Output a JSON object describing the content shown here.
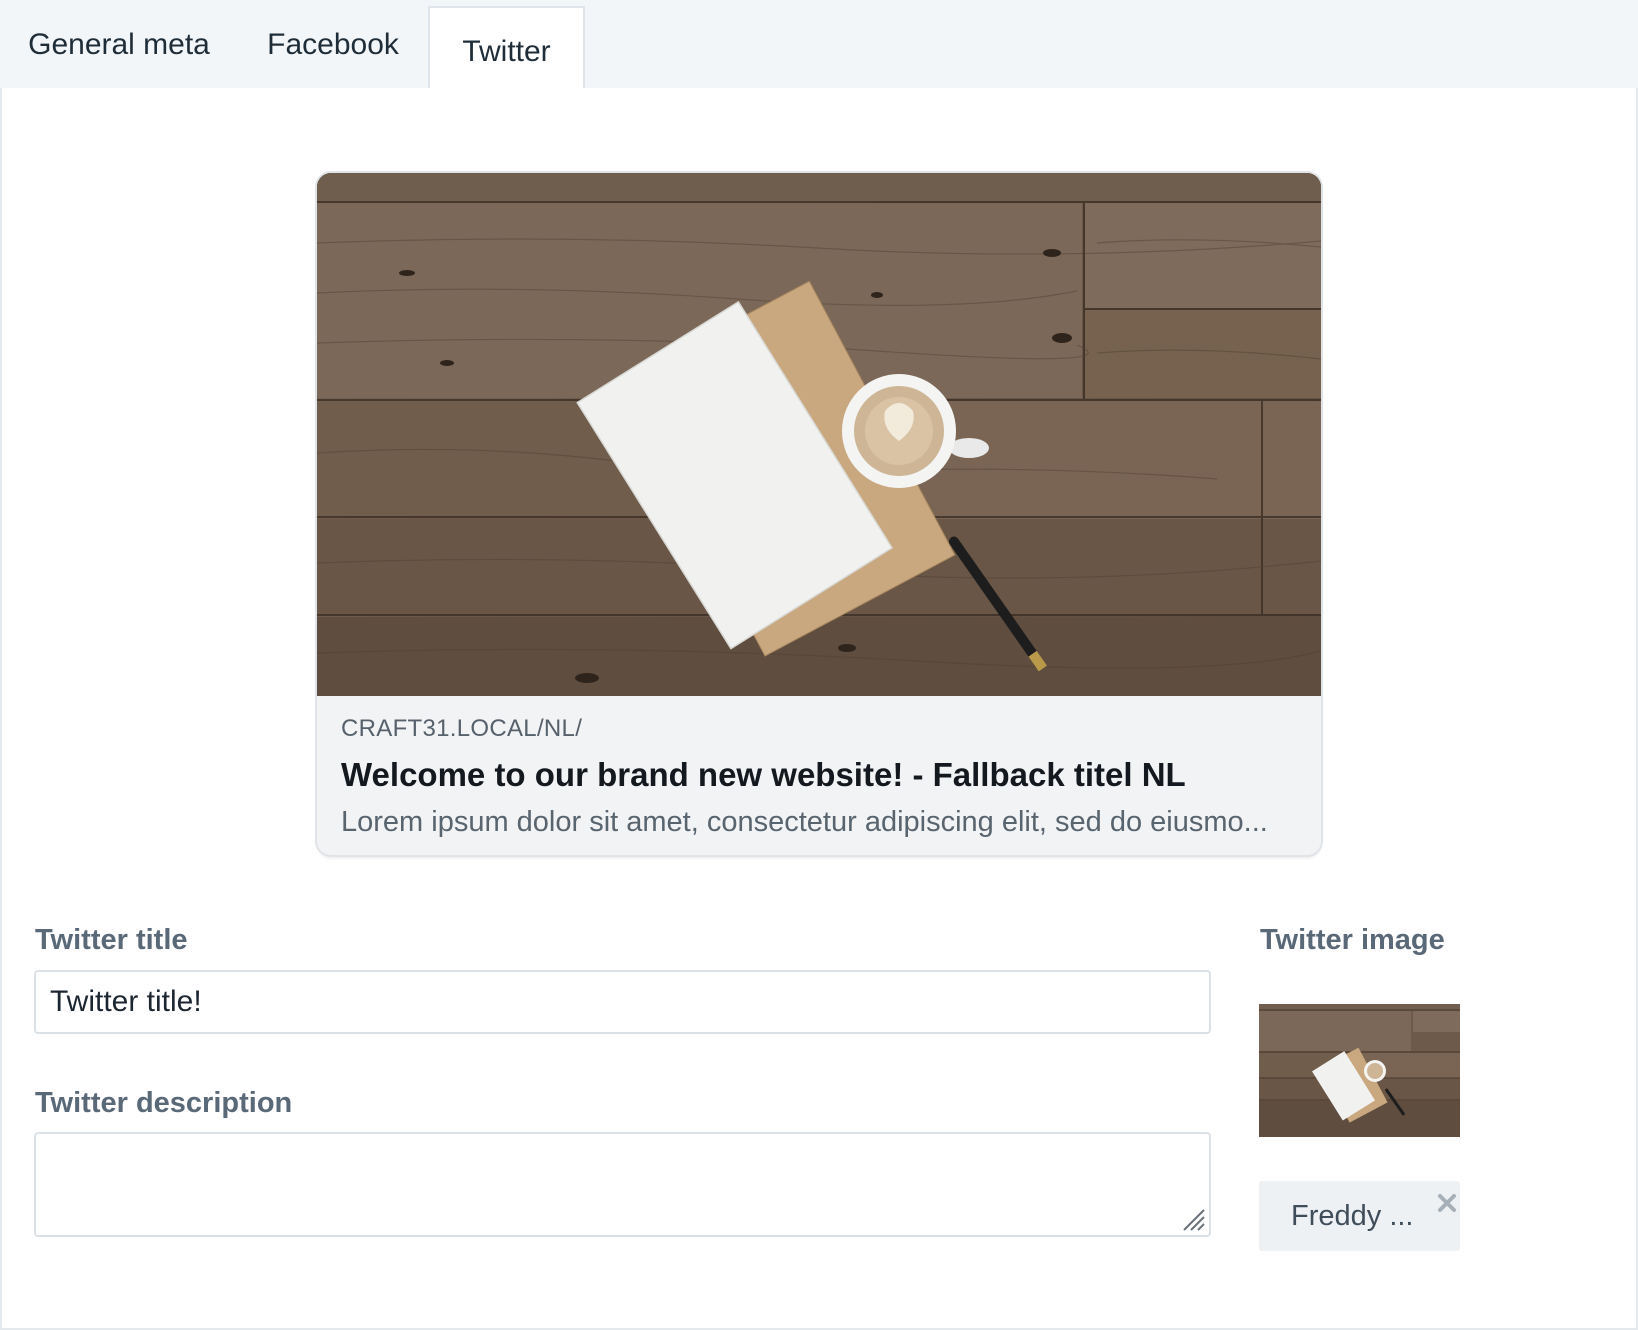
{
  "tabs": [
    {
      "label": "General meta",
      "active": false
    },
    {
      "label": "Facebook",
      "active": false
    },
    {
      "label": "Twitter",
      "active": true
    }
  ],
  "preview": {
    "image": "wooden-desk-with-notebooks-coffee-and-pen",
    "domain": "CRAFT31.LOCAL/NL/",
    "title": "Welcome to our brand new website! - Fallback titel NL",
    "description": "Lorem ipsum dolor sit amet, consectetur adipiscing elit, sed do eiusmo..."
  },
  "fields": {
    "title": {
      "label": "Twitter title",
      "value": "Twitter title!"
    },
    "description": {
      "label": "Twitter description",
      "value": ""
    },
    "image": {
      "label": "Twitter image",
      "asset_name": "Freddy ..."
    }
  },
  "colors": {
    "tab_bar_bg": "#f3f6f8",
    "label": "#5a6978",
    "card_bg": "#f2f3f5",
    "chip_bg": "#eef1f4"
  }
}
